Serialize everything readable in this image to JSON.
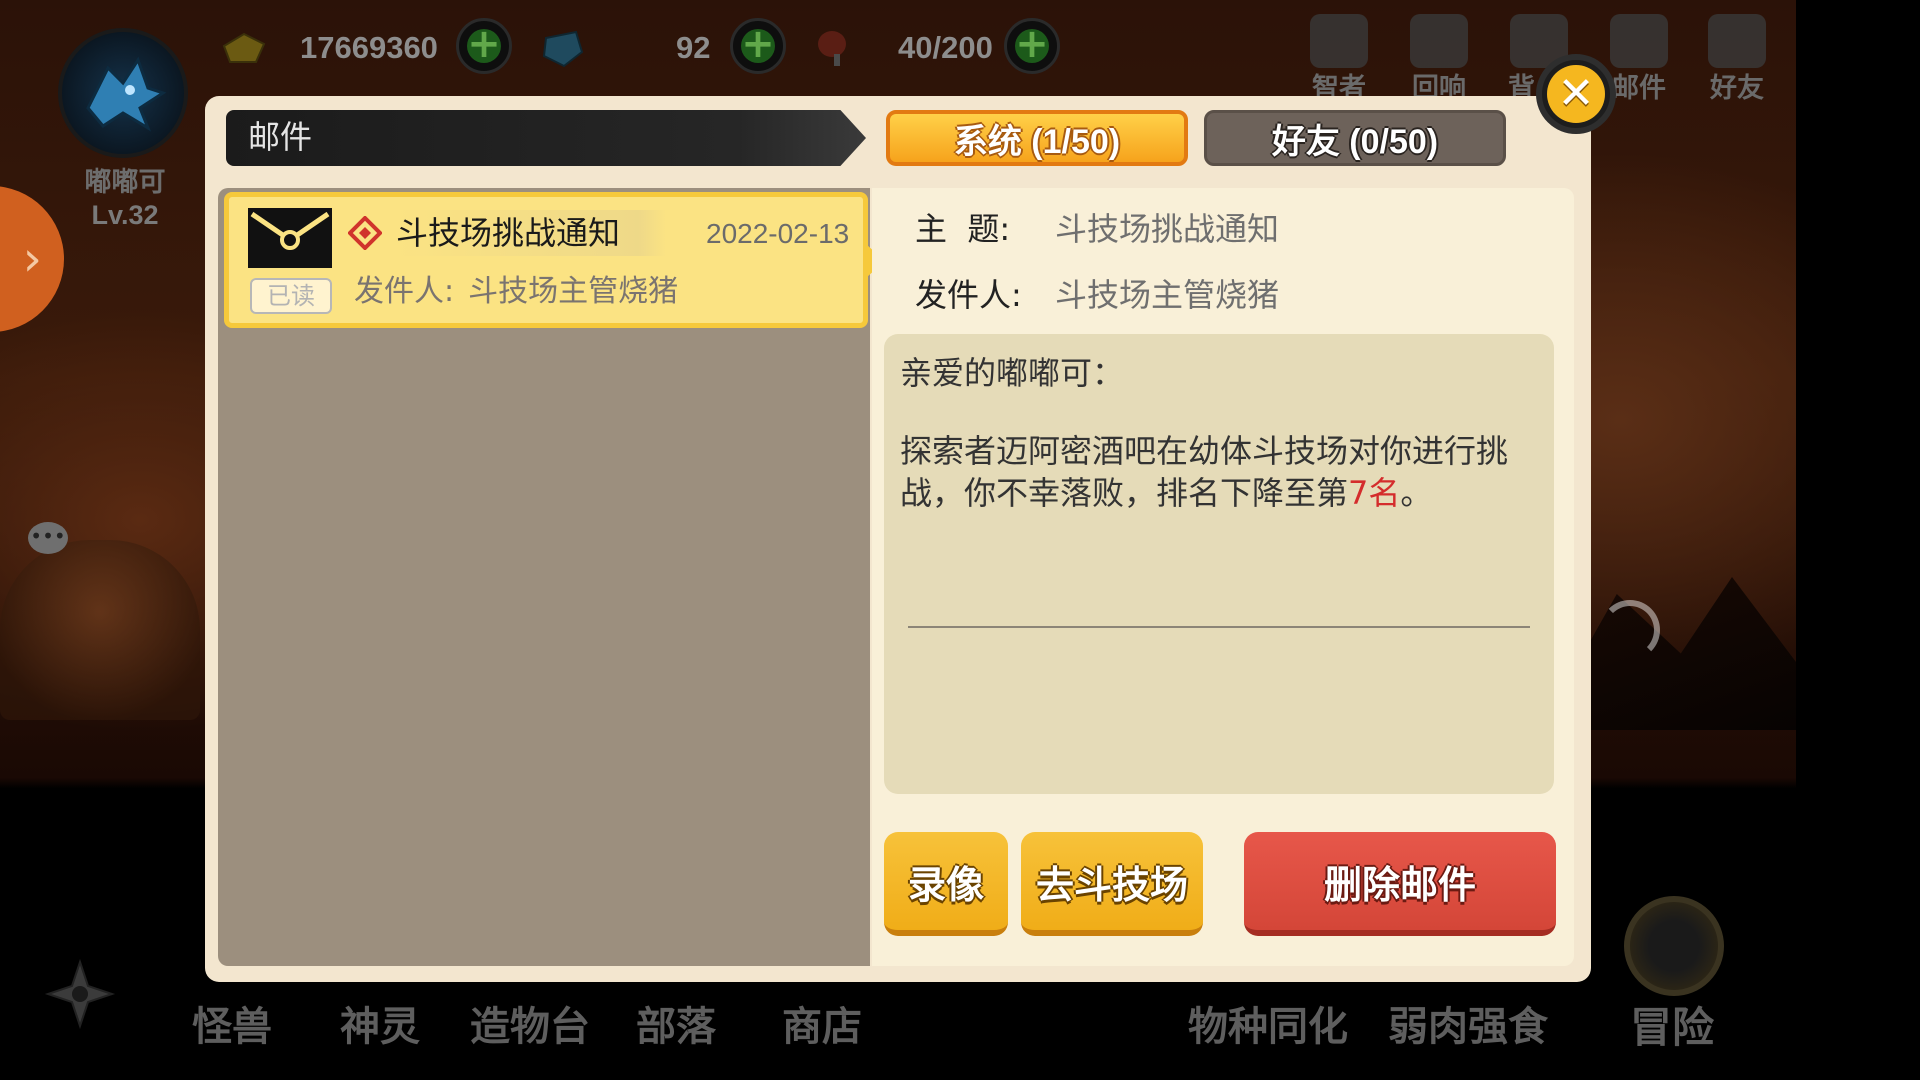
{
  "hud": {
    "resources": [
      {
        "icon": "gold-ingot-icon",
        "value": "17669360"
      },
      {
        "icon": "blue-gem-icon",
        "value": "92"
      },
      {
        "icon": "meat-drumstick-icon",
        "value": "40/200"
      }
    ],
    "player": {
      "name": "嘟嘟可",
      "level": "Lv.32",
      "avatar_icon": "blue-dragon-avatar-icon"
    },
    "top_menu": [
      {
        "label": "智者",
        "icon": "sage-bulb-icon"
      },
      {
        "label": "回响",
        "icon": "echo-scroll-icon"
      },
      {
        "label": "背",
        "icon": "backpack-icon"
      },
      {
        "label": "邮件",
        "icon": "mail-icon"
      },
      {
        "label": "好友",
        "icon": "friends-icon"
      }
    ],
    "side_arrow": "›",
    "chat_icon": "chat-bubble-icon"
  },
  "bottom_nav": [
    {
      "label": "怪兽"
    },
    {
      "label": "神灵"
    },
    {
      "label": "造物台"
    },
    {
      "label": "部落"
    },
    {
      "label": "商店"
    },
    {
      "label": "物种同化"
    },
    {
      "label": "弱肉强食"
    },
    {
      "label": "冒险"
    }
  ],
  "dialog": {
    "title": "邮件",
    "close_label": "✕",
    "tabs": {
      "system": "系统 (1/50)",
      "friends": "好友 (0/50)"
    },
    "mail_list": [
      {
        "status_badge": "已读",
        "subject": "斗技场挑战通知",
        "date": "2022-02-13",
        "sender_label": "发件人:",
        "sender": "斗技场主管烧猪"
      }
    ],
    "detail": {
      "subject_label": "主  题:",
      "subject": "斗技场挑战通知",
      "sender_label": "发件人:",
      "sender": "斗技场主管烧猪",
      "greeting": "亲爱的嘟嘟可：",
      "body_prefix": "探索者迈阿密酒吧在幼体斗技场对你进行挑战，你不幸落败，排名下降至第",
      "body_rank": "7名",
      "body_suffix": "。"
    },
    "buttons": {
      "replay": "录像",
      "goto_arena": "去斗技场",
      "delete": "删除邮件"
    }
  },
  "colors": {
    "accent_yellow": "#f6c93b",
    "delete_red": "#d44638",
    "rank_red": "#d42c2c"
  }
}
